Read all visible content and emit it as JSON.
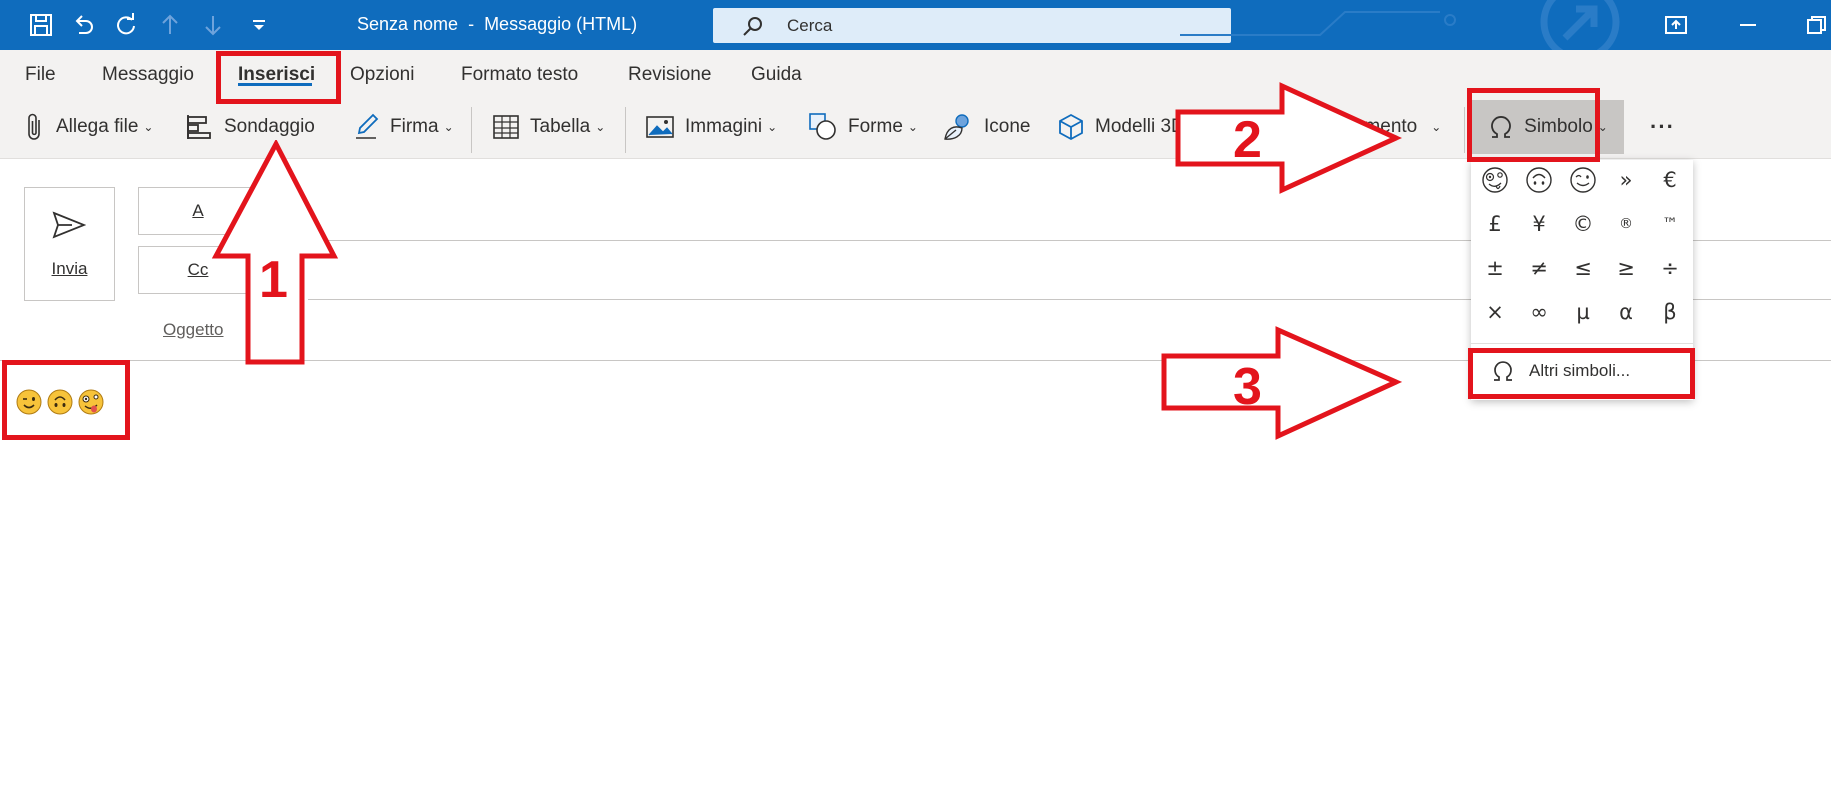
{
  "titlebar": {
    "title": "Senza nome  -  Messaggio (HTML)",
    "search_placeholder": "Cerca"
  },
  "menu": {
    "items": [
      "File",
      "Messaggio",
      "Inserisci",
      "Opzioni",
      "Formato testo",
      "Revisione",
      "Guida"
    ],
    "active": "Inserisci"
  },
  "ribbon": {
    "allega_file": "Allega file",
    "sondaggio": "Sondaggio",
    "firma": "Firma",
    "tabella": "Tabella",
    "immagini": "Immagini",
    "forme": "Forme",
    "icone": "Icone",
    "modelli_3d": "Modelli 3D",
    "collegamento": "Collegamento",
    "simbolo": "Simbolo",
    "more": "···"
  },
  "compose": {
    "send_label": "Invia",
    "to_label": "A",
    "cc_label": "Cc",
    "subject_label": "Oggetto",
    "body_emojis": [
      "winking-face",
      "upside-down-face",
      "zany-face"
    ]
  },
  "symbol_panel": {
    "row1_text": [
      "»",
      "€"
    ],
    "row1_emojis": [
      "zany-face",
      "upside-down-face",
      "winking-face"
    ],
    "symbols": [
      "£",
      "¥",
      "©",
      "®",
      "™",
      "±",
      "≠",
      "≤",
      "≥",
      "÷",
      "×",
      "∞",
      "µ",
      "α",
      "β"
    ],
    "more_symbols": "Altri simboli..."
  },
  "annotations": {
    "step1": "1",
    "step2": "2",
    "step3": "3",
    "color": "#e3141c"
  },
  "colors": {
    "accent": "#0f6cbd",
    "ribbon_bg": "#f3f2f1",
    "search_bg": "#deecf9"
  }
}
